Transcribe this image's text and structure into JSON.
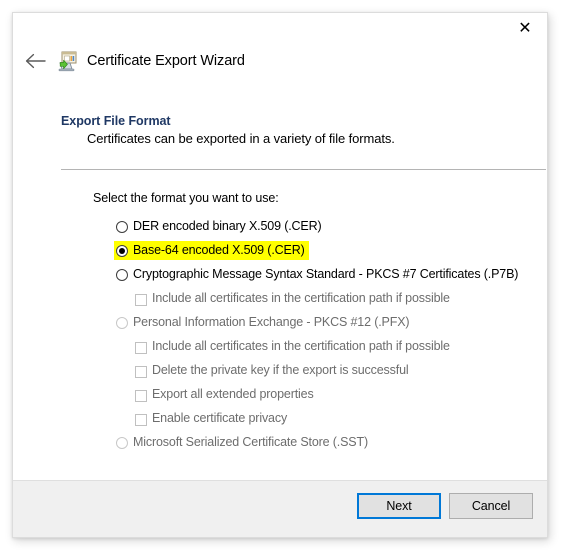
{
  "window": {
    "title": "Certificate Export Wizard",
    "icon": "certificate-export-icon",
    "close_label": "✕",
    "back_label": "←"
  },
  "page": {
    "heading": "Export File Format",
    "subheading": "Certificates can be exported in a variety of file formats.",
    "prompt": "Select the format you want to use:"
  },
  "options": [
    {
      "kind": "radio",
      "label": "DER encoded binary X.509 (.CER)",
      "selected": false,
      "disabled": false,
      "highlighted": false,
      "indent": "radio"
    },
    {
      "kind": "radio",
      "label": "Base-64 encoded X.509 (.CER)",
      "selected": true,
      "disabled": false,
      "highlighted": true,
      "indent": "radio"
    },
    {
      "kind": "radio",
      "label": "Cryptographic Message Syntax Standard - PKCS #7 Certificates (.P7B)",
      "selected": false,
      "disabled": false,
      "highlighted": false,
      "indent": "radio"
    },
    {
      "kind": "checkbox",
      "label": "Include all certificates in the certification path if possible",
      "checked": false,
      "disabled": true,
      "highlighted": false,
      "indent": "check"
    },
    {
      "kind": "radio",
      "label": "Personal Information Exchange - PKCS #12 (.PFX)",
      "selected": false,
      "disabled": true,
      "highlighted": false,
      "indent": "radio"
    },
    {
      "kind": "checkbox",
      "label": "Include all certificates in the certification path if possible",
      "checked": false,
      "disabled": true,
      "highlighted": false,
      "indent": "check"
    },
    {
      "kind": "checkbox",
      "label": "Delete the private key if the export is successful",
      "checked": false,
      "disabled": true,
      "highlighted": false,
      "indent": "check"
    },
    {
      "kind": "checkbox",
      "label": "Export all extended properties",
      "checked": false,
      "disabled": true,
      "highlighted": false,
      "indent": "check"
    },
    {
      "kind": "checkbox",
      "label": "Enable certificate privacy",
      "checked": false,
      "disabled": true,
      "highlighted": false,
      "indent": "check"
    },
    {
      "kind": "radio",
      "label": "Microsoft Serialized Certificate Store (.SST)",
      "selected": false,
      "disabled": true,
      "highlighted": false,
      "indent": "radio"
    }
  ],
  "footer": {
    "next_label": "Next",
    "cancel_label": "Cancel"
  },
  "colors": {
    "heading": "#1f3864",
    "highlight": "#ffff00",
    "focus_border": "#0078d7",
    "disabled_text": "#6d6d6d",
    "footer_bg": "#f0f0f0"
  }
}
